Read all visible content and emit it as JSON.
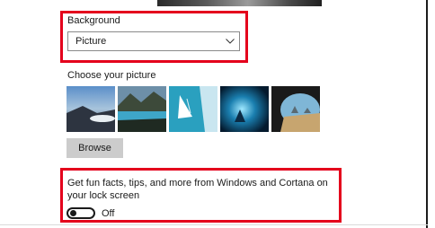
{
  "background": {
    "label": "Background",
    "selected": "Picture"
  },
  "choose_picture": {
    "label": "Choose your picture",
    "thumbnails": [
      {
        "icon": "lake-sunrise-thumbnail"
      },
      {
        "icon": "mountain-lake-thumbnail"
      },
      {
        "icon": "sailboat-aerial-thumbnail"
      },
      {
        "icon": "ice-cave-thumbnail"
      },
      {
        "icon": "beach-cave-thumbnail"
      }
    ],
    "browse_label": "Browse"
  },
  "fun_facts": {
    "text": "Get fun facts, tips, and more from Windows and Cortana on your lock screen",
    "toggle_state": "Off"
  },
  "colors": {
    "highlight": "#e4001c",
    "button_bg": "#cccccc"
  }
}
